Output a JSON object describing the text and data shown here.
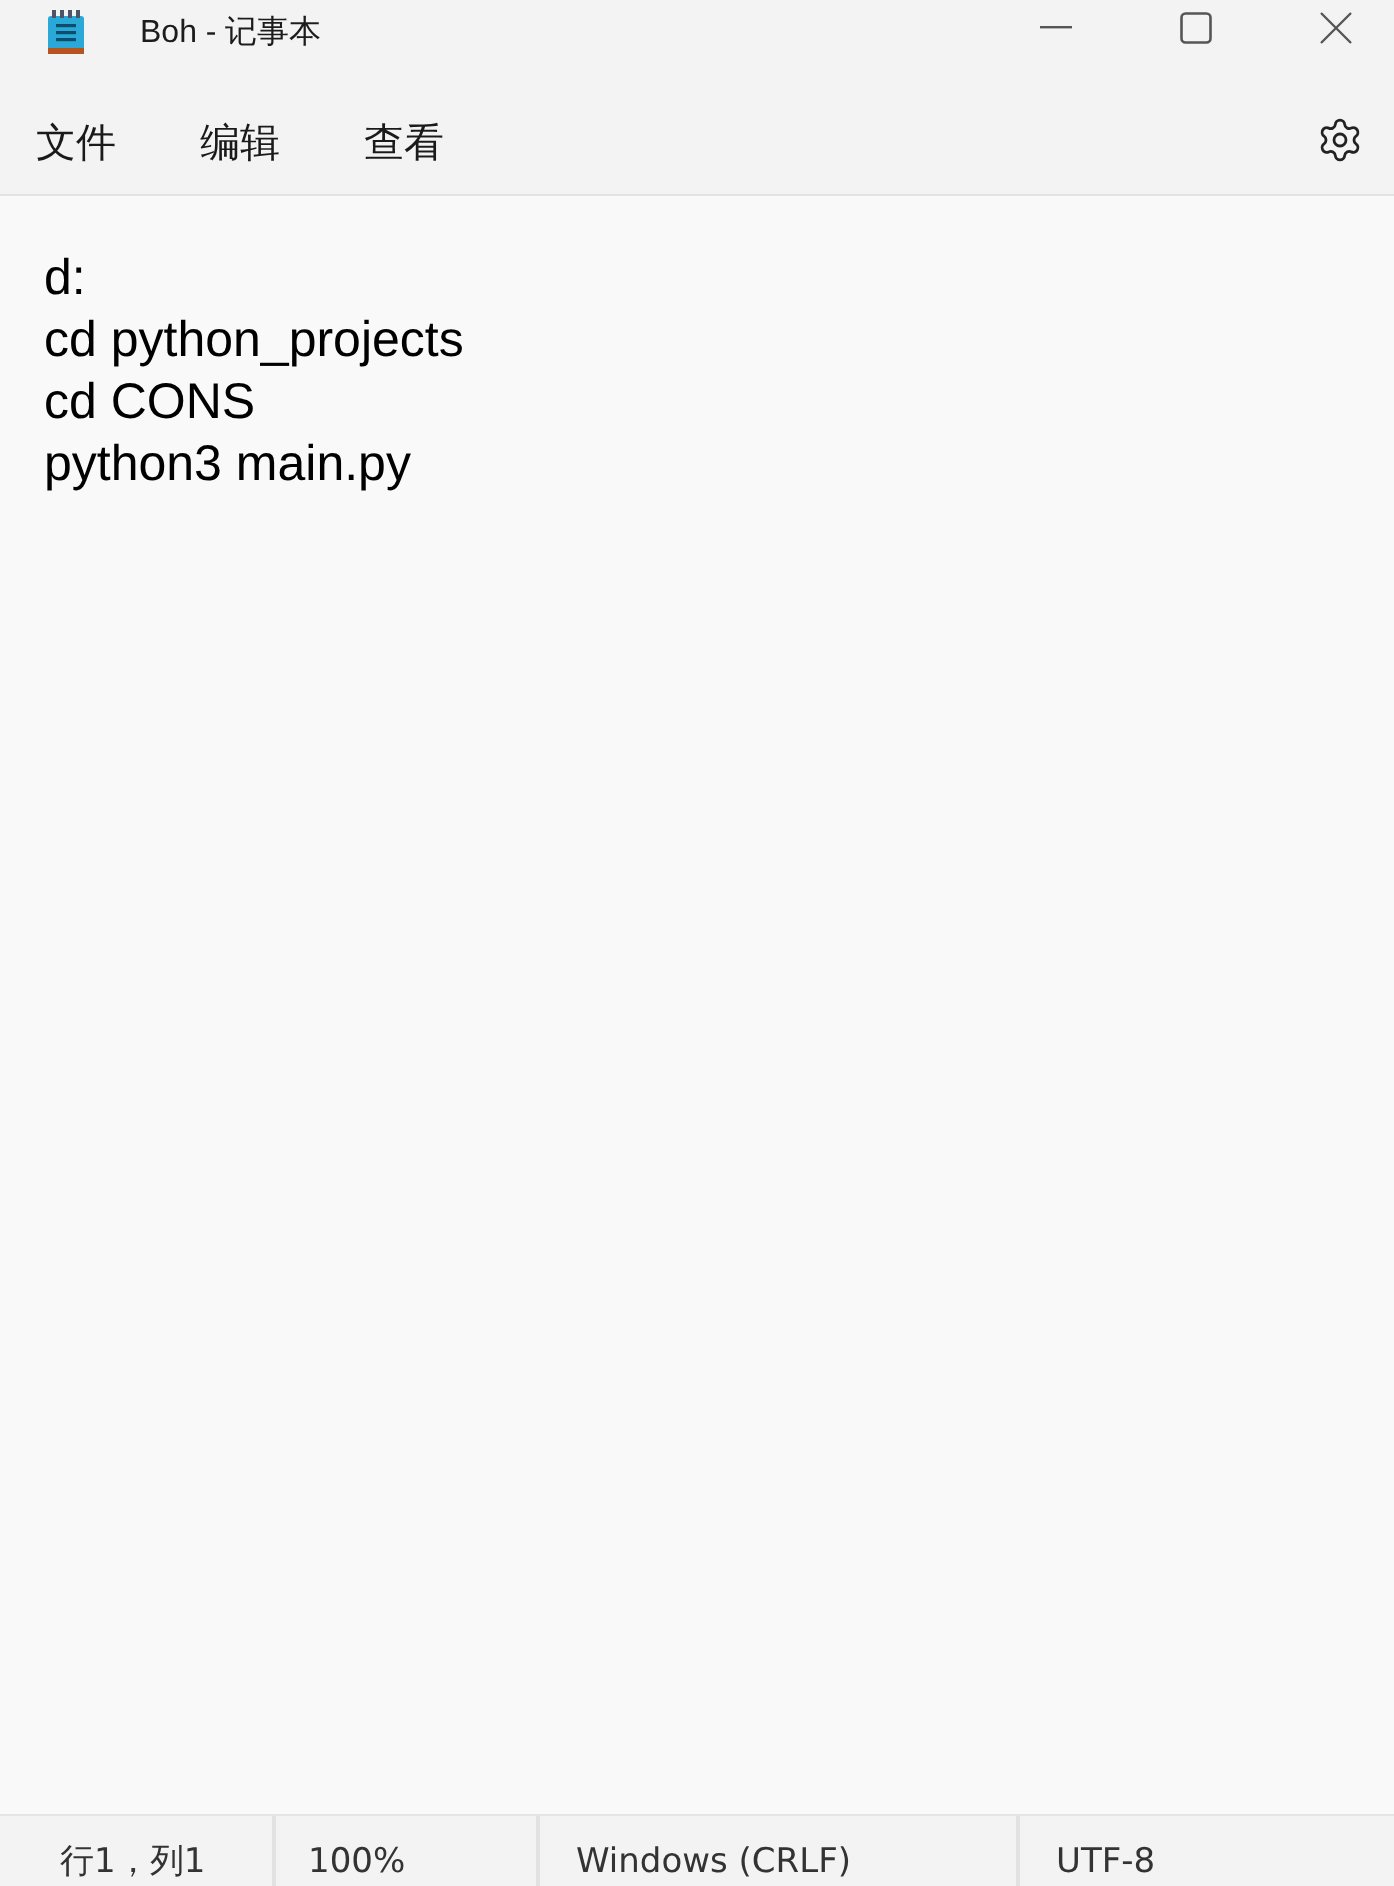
{
  "window": {
    "title": "Boh - 记事本"
  },
  "menu": [
    "文件",
    "编辑",
    "查看"
  ],
  "editor": {
    "lines": [
      "d:",
      "cd python_projects",
      "cd CONS",
      "python3 main.py"
    ]
  },
  "status_bar": [
    "行1，列1",
    "100%",
    "Windows (CRLF)",
    "UTF-8"
  ]
}
